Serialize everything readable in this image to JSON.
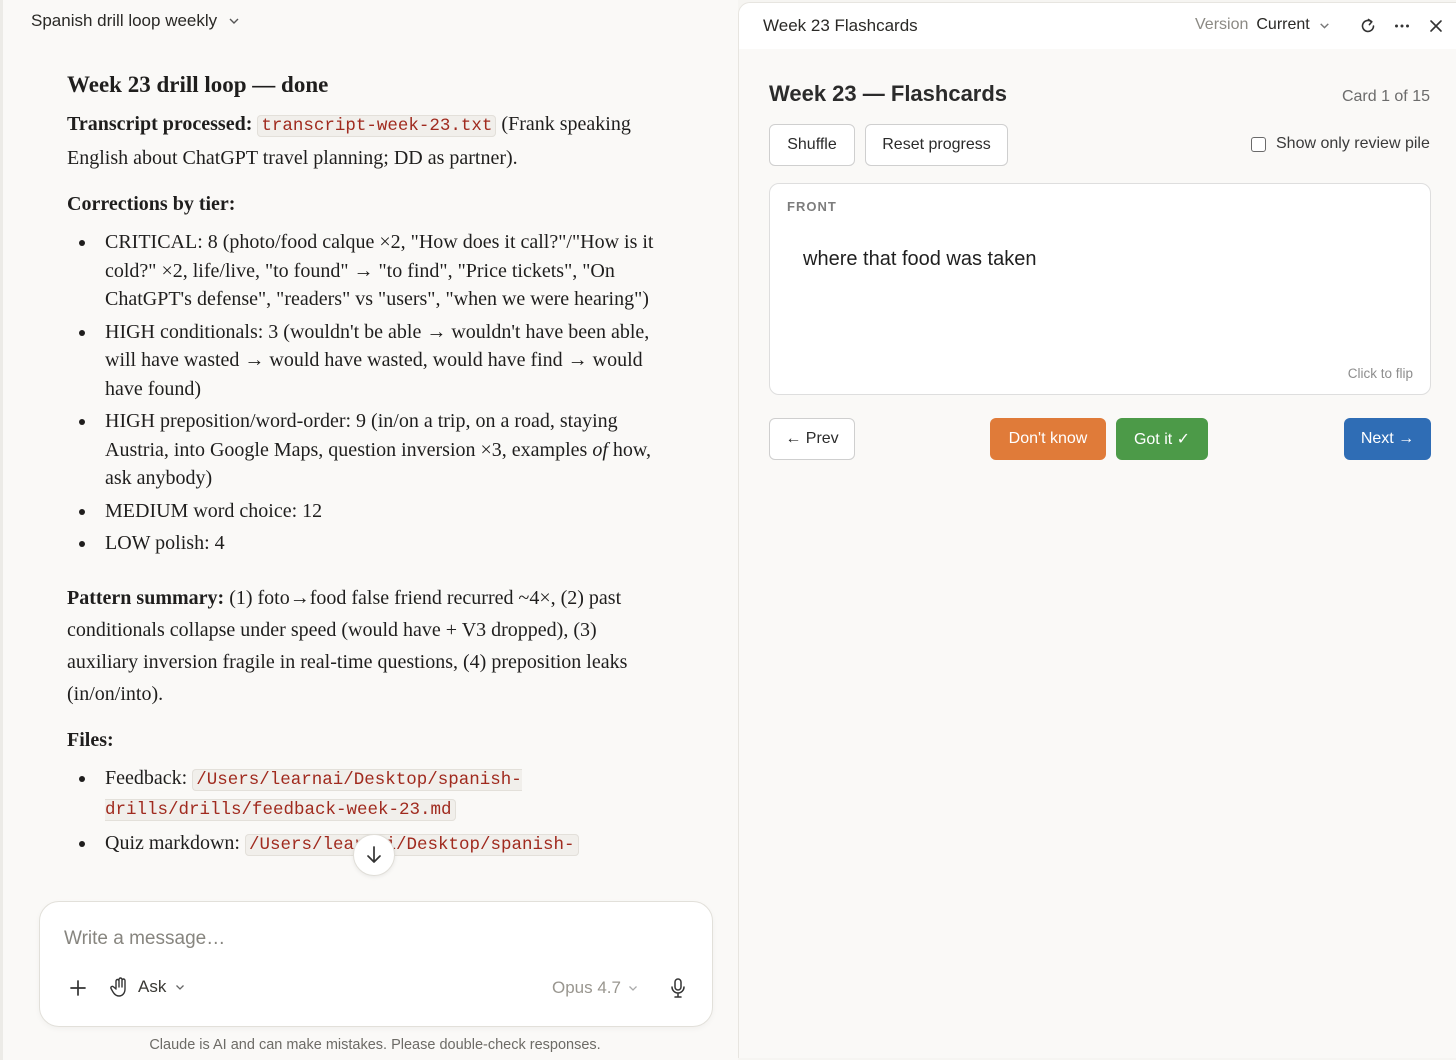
{
  "chat": {
    "title": "Spanish drill loop weekly",
    "heading": "Week 23 drill loop — done",
    "transcript_label": "Transcript processed:",
    "transcript_file": "transcript-week-23.txt",
    "transcript_note": "(Frank speaking English about ChatGPT travel planning; DD as partner).",
    "corrections_label": "Corrections by tier:",
    "corrections": [
      "CRITICAL: 8 (photo/food calque ×2, \"How does it call?\"/\"How is it cold?\" ×2, life/live, \"to found\" → \"to find\", \"Price tickets\", \"On ChatGPT's defense\", \"readers\" vs \"users\", \"when we were hearing\")",
      "HIGH conditionals: 3 (wouldn't be able → wouldn't have been able, will have wasted → would have wasted, would have find → would have found)",
      "HIGH preposition/word-order: 9 (in/on a trip, on a road, staying Austria, into Google Maps, question inversion ×3, examples",
      "MEDIUM word choice: 12",
      "LOW polish: 4"
    ],
    "correction_3_italic": "of",
    "correction_3_tail": "how, ask anybody)",
    "pattern_label": "Pattern summary:",
    "pattern_text": "(1) foto→food false friend recurred ~4×, (2) past conditionals collapse under speed (would have + V3 dropped), (3) auxiliary inversion fragile in real-time questions, (4) preposition leaks (in/on/into).",
    "files_label": "Files:",
    "files": [
      {
        "label": "Feedback:",
        "path": "/Users/learnai/Desktop/spanish-drills/drills/feedback-week-23.md"
      },
      {
        "label": "Quiz markdown:",
        "path": "/Users/learnai/Desktop/spanish-"
      }
    ],
    "composer_placeholder": "Write a message…",
    "mode": "Ask",
    "model": "Opus 4.7",
    "disclaimer": "Claude is AI and can make mistakes. Please double-check responses."
  },
  "artifact": {
    "title": "Week 23 Flashcards",
    "version_label": "Version",
    "version_value": "Current",
    "heading": "Week 23 — Flashcards",
    "card_count": "Card 1 of 15",
    "shuffle": "Shuffle",
    "reset": "Reset progress",
    "review_toggle": "Show only review pile",
    "review_checked": false,
    "card_side": "FRONT",
    "card_text": "where that food was taken",
    "card_hint": "Click to flip",
    "prev": "← Prev",
    "dont_know": "Don't know",
    "got_it": "Got it ✓",
    "next": "Next →",
    "colors": {
      "dont_know": "#e07b39",
      "got_it": "#4c9a48",
      "next": "#2f6db5"
    }
  }
}
